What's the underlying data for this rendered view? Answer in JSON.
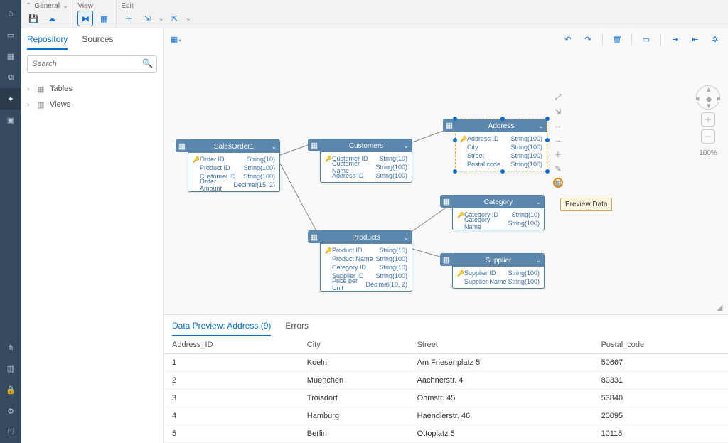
{
  "toolbar": {
    "general_label": "General",
    "view_label": "View",
    "edit_label": "Edit"
  },
  "sidebar": {
    "tabs": [
      "Repository",
      "Sources"
    ],
    "search_placeholder": "Search",
    "tree": [
      {
        "label": "Tables"
      },
      {
        "label": "Views"
      }
    ]
  },
  "entities": {
    "salesorder": {
      "title": "SalesOrder1",
      "fields": [
        {
          "key": true,
          "name": "Order ID",
          "type": "String(10)"
        },
        {
          "key": false,
          "name": "Product ID",
          "type": "String(100)"
        },
        {
          "key": false,
          "name": "Customer ID",
          "type": "String(100)"
        },
        {
          "key": false,
          "name": "Order Amount",
          "type": "Decimal(15, 2)"
        }
      ]
    },
    "customers": {
      "title": "Customers",
      "fields": [
        {
          "key": true,
          "name": "Customer ID",
          "type": "String(10)"
        },
        {
          "key": false,
          "name": "Customer Name",
          "type": "String(100)"
        },
        {
          "key": false,
          "name": "Address ID",
          "type": "String(100)"
        }
      ]
    },
    "address": {
      "title": "Address",
      "fields": [
        {
          "key": true,
          "name": "Address ID",
          "type": "String(100)"
        },
        {
          "key": false,
          "name": "City",
          "type": "String(100)"
        },
        {
          "key": false,
          "name": "Street",
          "type": "String(100)"
        },
        {
          "key": false,
          "name": "Postal code",
          "type": "String(100)"
        }
      ]
    },
    "category": {
      "title": "Category",
      "fields": [
        {
          "key": true,
          "name": "Category ID",
          "type": "String(10)"
        },
        {
          "key": false,
          "name": "Category Name",
          "type": "String(100)"
        }
      ]
    },
    "products": {
      "title": "Products",
      "fields": [
        {
          "key": true,
          "name": "Product ID",
          "type": "String(10)"
        },
        {
          "key": false,
          "name": "Product Name",
          "type": "String(100)"
        },
        {
          "key": false,
          "name": "Category ID",
          "type": "String(10)"
        },
        {
          "key": false,
          "name": "Supplier ID",
          "type": "String(100)"
        },
        {
          "key": false,
          "name": "Price per Unit",
          "type": "Decimal(10, 2)"
        }
      ]
    },
    "supplier": {
      "title": "Supplier",
      "fields": [
        {
          "key": true,
          "name": "Supplier ID",
          "type": "String(100)"
        },
        {
          "key": false,
          "name": "Supplier Name",
          "type": "String(100)"
        }
      ]
    }
  },
  "tooltip": "Preview Data",
  "zoom": "100%",
  "preview": {
    "tab_data": "Data Preview: Address (9)",
    "tab_errors": "Errors",
    "columns": [
      "Address_ID",
      "City",
      "Street",
      "Postal_code"
    ],
    "rows": [
      [
        "1",
        "Koeln",
        "Am Friesenplatz 5",
        "50667"
      ],
      [
        "2",
        "Muenchen",
        "Aachnerstr. 4",
        "80331"
      ],
      [
        "3",
        "Troisdorf",
        "Ohmstr. 45",
        "53840"
      ],
      [
        "4",
        "Hamburg",
        "Haendlerstr. 46",
        "20095"
      ],
      [
        "5",
        "Berlin",
        "Ottoplatz 5",
        "10115"
      ]
    ]
  }
}
